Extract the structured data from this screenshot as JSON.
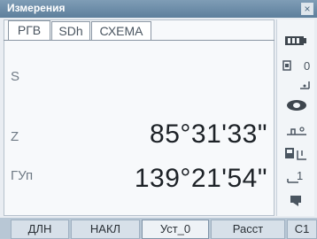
{
  "window": {
    "title": "Измерения",
    "close_label": "×"
  },
  "tabs": [
    {
      "label": "РГВ",
      "active": true
    },
    {
      "label": "SDh",
      "active": false
    },
    {
      "label": "СХЕМА",
      "active": false
    }
  ],
  "rows": [
    {
      "label": "S",
      "value": ""
    },
    {
      "label": "Z",
      "value": "85°31'33\""
    },
    {
      "label": "ГУп",
      "value": "139°21'54\""
    }
  ],
  "sidebar": {
    "item_1": "0",
    "item_2": "1"
  },
  "softkeys": [
    {
      "label": "ДЛН"
    },
    {
      "label": "НАКЛ"
    },
    {
      "label": "Уст_0"
    },
    {
      "label": "Расст"
    },
    {
      "label": "С1"
    }
  ],
  "colors": {
    "titlebar": "#6a89a6",
    "softkey_bar": "#b8c7d5",
    "value_text": "#1d2227"
  }
}
